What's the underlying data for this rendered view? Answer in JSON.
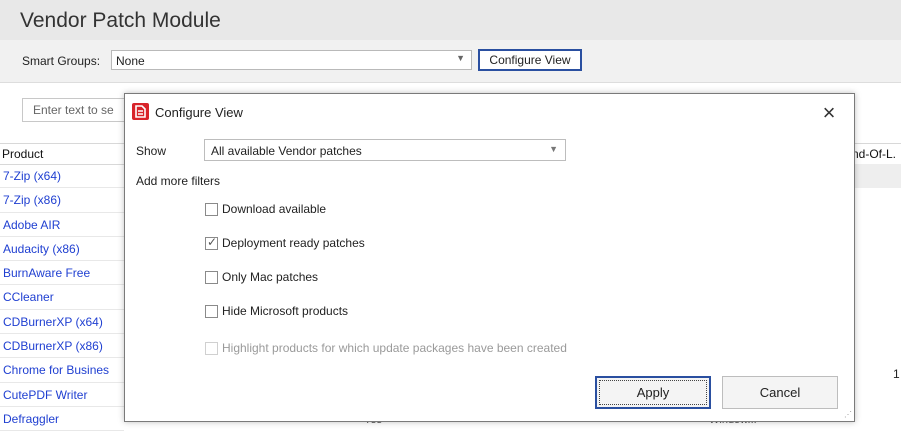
{
  "app": {
    "title": "Vendor Patch Module"
  },
  "smart_groups": {
    "label": "Smart Groups:",
    "value": "None",
    "configure_label": "Configure View"
  },
  "search": {
    "placeholder": "Enter text to se"
  },
  "grid": {
    "columns": {
      "product": "Product",
      "end_of_life": "nd-Of-L."
    },
    "products": [
      "7-Zip (x64)",
      "7-Zip (x86)",
      "Adobe AIR",
      "Audacity (x86)",
      "BurnAware Free",
      "CCleaner",
      "CDBurnerXP (x64)",
      "CDBurnerXP (x86)",
      "Chrome for Busines",
      "CutePDF Writer",
      "Defraggler"
    ],
    "right_value": "1",
    "bottom_partial": [
      "Yes",
      "-",
      "- -",
      "Window..."
    ]
  },
  "dialog": {
    "title": "Configure View",
    "show_label": "Show",
    "show_value": "All available Vendor patches",
    "add_filters_label": "Add more filters",
    "filters": [
      {
        "label": "Download available",
        "checked": false,
        "disabled": false
      },
      {
        "label": "Deployment ready patches",
        "checked": true,
        "disabled": false
      },
      {
        "label": "Only Mac patches",
        "checked": false,
        "disabled": false
      },
      {
        "label": "Hide Microsoft products",
        "checked": false,
        "disabled": false
      },
      {
        "label": "Highlight products for which update packages have been created",
        "checked": false,
        "disabled": true
      }
    ],
    "apply_label": "Apply",
    "cancel_label": "Cancel"
  },
  "colors": {
    "link": "#1f3fd1",
    "focus_border": "#2a4fa0",
    "icon_red": "#d8232a"
  }
}
